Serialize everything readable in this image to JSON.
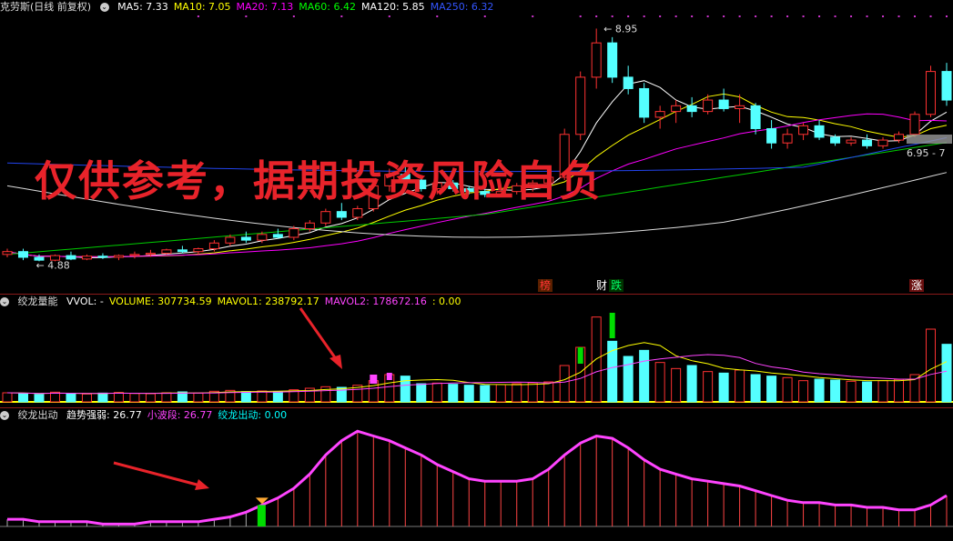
{
  "main": {
    "title": "克劳斯(日线 前复权)",
    "ma": [
      {
        "label": "MA5: 7.33",
        "color": "#ffffff"
      },
      {
        "label": "MA10: 7.05",
        "color": "#ffff00"
      },
      {
        "label": "MA20: 7.13",
        "color": "#ff00ff"
      },
      {
        "label": "MA60: 6.42",
        "color": "#00ff00"
      },
      {
        "label": "MA120: 5.85",
        "color": "#ffffff"
      },
      {
        "label": "MA250: 6.32",
        "color": "#3355ff"
      }
    ],
    "high_label": "8.95",
    "low_label": "4.88",
    "range_label": "6.95 - 7",
    "tags": [
      {
        "text": "榜",
        "color": "#ff3333",
        "bg": "#7a2a00"
      },
      {
        "text": "财",
        "color": "#ffffff",
        "bg": "#000000"
      },
      {
        "text": "跌",
        "color": "#00ff66",
        "bg": "#004400"
      },
      {
        "text": "涨",
        "color": "#ffffff",
        "bg": "#7a1a1a"
      }
    ],
    "watermark": "仅供参考，据期投资风险自负"
  },
  "volume": {
    "title": "绞龙量能",
    "indicators": [
      {
        "label": "VVOL: -",
        "color": "#ffffff"
      },
      {
        "label": "VOLUME: 307734.59",
        "color": "#ffff00"
      },
      {
        "label": "MAVOL1: 238792.17",
        "color": "#ffff00"
      },
      {
        "label": "MAVOL2: 178672.16",
        "color": "#ff44ff"
      },
      {
        "label": ": 0.00",
        "color": "#ffff00"
      }
    ]
  },
  "strength": {
    "title": "绞龙出动",
    "indicators": [
      {
        "label": "趋势强弱: 26.77",
        "color": "#ffffff"
      },
      {
        "label": "小波段: 26.77",
        "color": "#ff44ff"
      },
      {
        "label": "绞龙出动: 0.00",
        "color": "#00ffff"
      }
    ]
  },
  "chart_data": {
    "type": "candlestick",
    "title": "克劳斯(日线 前复权)",
    "candles_ohlc": [
      [
        5.0,
        5.1,
        4.95,
        5.05
      ],
      [
        5.05,
        5.1,
        4.9,
        4.95
      ],
      [
        4.95,
        5.0,
        4.88,
        4.9
      ],
      [
        4.9,
        5.0,
        4.88,
        4.98
      ],
      [
        4.98,
        5.05,
        4.9,
        4.92
      ],
      [
        4.92,
        5.0,
        4.9,
        4.97
      ],
      [
        4.97,
        5.02,
        4.92,
        4.95
      ],
      [
        4.95,
        5.0,
        4.9,
        4.98
      ],
      [
        4.98,
        5.05,
        4.93,
        5.0
      ],
      [
        5.0,
        5.08,
        4.96,
        5.02
      ],
      [
        5.02,
        5.1,
        5.0,
        5.08
      ],
      [
        5.08,
        5.15,
        5.02,
        5.05
      ],
      [
        5.05,
        5.12,
        5.0,
        5.1
      ],
      [
        5.1,
        5.25,
        5.05,
        5.2
      ],
      [
        5.2,
        5.35,
        5.15,
        5.3
      ],
      [
        5.3,
        5.4,
        5.2,
        5.25
      ],
      [
        5.25,
        5.4,
        5.2,
        5.35
      ],
      [
        5.35,
        5.45,
        5.28,
        5.3
      ],
      [
        5.3,
        5.5,
        5.25,
        5.45
      ],
      [
        5.45,
        5.6,
        5.4,
        5.55
      ],
      [
        5.55,
        5.8,
        5.5,
        5.75
      ],
      [
        5.75,
        5.9,
        5.6,
        5.65
      ],
      [
        5.65,
        5.85,
        5.6,
        5.8
      ],
      [
        5.8,
        6.3,
        5.75,
        6.2
      ],
      [
        6.2,
        6.5,
        6.1,
        6.4
      ],
      [
        6.4,
        6.55,
        6.2,
        6.3
      ],
      [
        6.3,
        6.35,
        6.1,
        6.15
      ],
      [
        6.15,
        6.3,
        6.05,
        6.25
      ],
      [
        6.25,
        6.3,
        6.1,
        6.15
      ],
      [
        6.15,
        6.2,
        6.05,
        6.1
      ],
      [
        6.1,
        6.2,
        6.0,
        6.05
      ],
      [
        6.05,
        6.15,
        6.0,
        6.1
      ],
      [
        6.1,
        6.25,
        6.05,
        6.2
      ],
      [
        6.2,
        6.3,
        6.1,
        6.25
      ],
      [
        6.25,
        6.4,
        6.2,
        6.35
      ],
      [
        6.35,
        7.2,
        6.3,
        7.1
      ],
      [
        7.1,
        8.2,
        7.0,
        8.1
      ],
      [
        8.1,
        8.95,
        7.9,
        8.7
      ],
      [
        8.7,
        8.8,
        8.0,
        8.1
      ],
      [
        8.1,
        8.3,
        7.8,
        7.9
      ],
      [
        7.9,
        8.0,
        7.3,
        7.4
      ],
      [
        7.4,
        7.6,
        7.2,
        7.5
      ],
      [
        7.5,
        7.7,
        7.3,
        7.6
      ],
      [
        7.6,
        7.75,
        7.4,
        7.5
      ],
      [
        7.5,
        7.8,
        7.45,
        7.7
      ],
      [
        7.7,
        7.9,
        7.5,
        7.55
      ],
      [
        7.55,
        7.8,
        7.3,
        7.6
      ],
      [
        7.6,
        7.65,
        7.1,
        7.2
      ],
      [
        7.2,
        7.35,
        6.85,
        6.95
      ],
      [
        6.95,
        7.2,
        6.85,
        7.1
      ],
      [
        7.1,
        7.3,
        7.0,
        7.25
      ],
      [
        7.25,
        7.35,
        7.0,
        7.05
      ],
      [
        7.05,
        7.1,
        6.9,
        6.95
      ],
      [
        6.95,
        7.05,
        6.9,
        7.0
      ],
      [
        7.0,
        7.1,
        6.85,
        6.9
      ],
      [
        6.9,
        7.05,
        6.85,
        7.0
      ],
      [
        7.0,
        7.15,
        6.95,
        7.1
      ],
      [
        7.1,
        7.5,
        7.05,
        7.45
      ],
      [
        7.45,
        8.3,
        7.4,
        8.2
      ],
      [
        8.2,
        8.35,
        7.6,
        7.7
      ]
    ],
    "high": 8.95,
    "low": 4.88,
    "ma_latest": {
      "MA5": 7.33,
      "MA10": 7.05,
      "MA20": 7.13,
      "MA60": 6.42,
      "MA120": 5.85,
      "MA250": 6.32
    },
    "volume_latest": {
      "VOLUME": 307734.59,
      "MAVOL1": 238792.17,
      "MAVOL2": 178672.16
    },
    "volume_values": [
      30,
      28,
      25,
      32,
      27,
      26,
      29,
      31,
      28,
      27,
      30,
      33,
      29,
      35,
      38,
      34,
      36,
      33,
      40,
      45,
      50,
      48,
      55,
      70,
      90,
      85,
      60,
      62,
      58,
      55,
      54,
      57,
      60,
      63,
      66,
      120,
      180,
      280,
      200,
      150,
      170,
      130,
      110,
      120,
      100,
      95,
      105,
      90,
      85,
      80,
      70,
      75,
      72,
      68,
      66,
      70,
      74,
      90,
      240,
      190
    ],
    "strength_values": [
      3,
      3,
      2,
      2,
      2,
      2,
      1,
      1,
      1,
      2,
      2,
      2,
      2,
      3,
      4,
      6,
      9,
      12,
      16,
      22,
      30,
      36,
      40,
      38,
      36,
      33,
      30,
      26,
      23,
      20,
      19,
      19,
      19,
      20,
      24,
      30,
      35,
      38,
      37,
      33,
      28,
      24,
      22,
      20,
      19,
      18,
      17,
      15,
      13,
      11,
      10,
      10,
      9,
      9,
      8,
      8,
      7,
      7,
      9,
      13
    ]
  }
}
